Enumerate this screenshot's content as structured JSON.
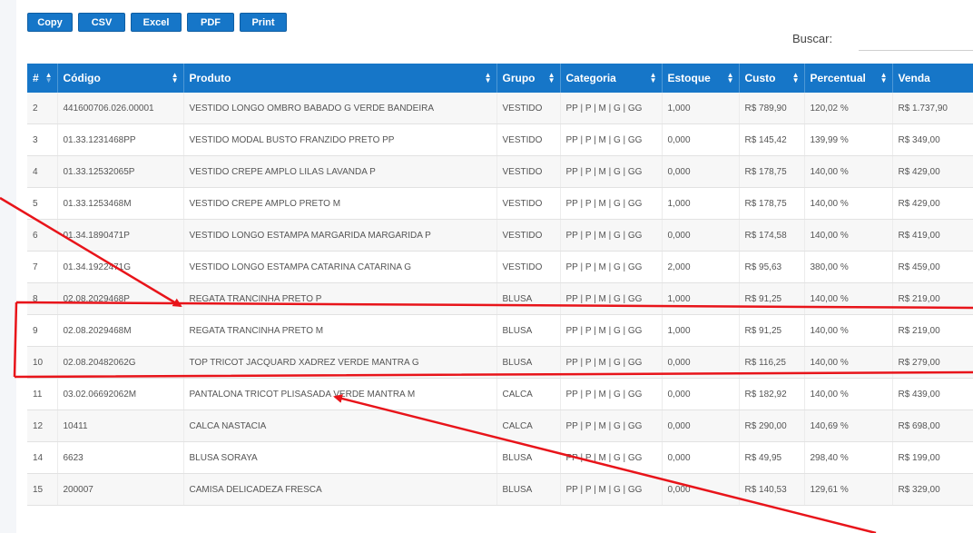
{
  "toolbar": {
    "copy_label": "Copy",
    "csv_label": "CSV",
    "excel_label": "Excel",
    "pdf_label": "PDF",
    "print_label": "Print"
  },
  "search": {
    "label": "Buscar:",
    "value": ""
  },
  "table": {
    "headers": [
      "#",
      "Código",
      "Produto",
      "Grupo",
      "Categoria",
      "Estoque",
      "Custo",
      "Percentual",
      "Venda"
    ],
    "rows": [
      [
        "2",
        "441600706.026.00001",
        "VESTIDO LONGO OMBRO BABADO G VERDE BANDEIRA",
        "VESTIDO",
        "PP | P | M | G | GG",
        "1,000",
        "R$ 789,90",
        "120,02 %",
        "R$ 1.737,90"
      ],
      [
        "3",
        "01.33.1231468PP",
        "VESTIDO MODAL BUSTO FRANZIDO PRETO PP",
        "VESTIDO",
        "PP | P | M | G | GG",
        "0,000",
        "R$ 145,42",
        "139,99 %",
        "R$ 349,00"
      ],
      [
        "4",
        "01.33.12532065P",
        "VESTIDO CREPE AMPLO LILAS LAVANDA P",
        "VESTIDO",
        "PP | P | M | G | GG",
        "0,000",
        "R$ 178,75",
        "140,00 %",
        "R$ 429,00"
      ],
      [
        "5",
        "01.33.1253468M",
        "VESTIDO CREPE AMPLO PRETO M",
        "VESTIDO",
        "PP | P | M | G | GG",
        "1,000",
        "R$ 178,75",
        "140,00 %",
        "R$ 429,00"
      ],
      [
        "6",
        "01.34.1890471P",
        "VESTIDO LONGO ESTAMPA MARGARIDA MARGARIDA P",
        "VESTIDO",
        "PP | P | M | G | GG",
        "0,000",
        "R$ 174,58",
        "140,00 %",
        "R$ 419,00"
      ],
      [
        "7",
        "01.34.1922471G",
        "VESTIDO LONGO ESTAMPA CATARINA CATARINA G",
        "VESTIDO",
        "PP | P | M | G | GG",
        "2,000",
        "R$ 95,63",
        "380,00 %",
        "R$ 459,00"
      ],
      [
        "8",
        "02.08.2029468P",
        "REGATA TRANCINHA PRETO P",
        "BLUSA",
        "PP | P | M | G | GG",
        "1,000",
        "R$ 91,25",
        "140,00 %",
        "R$ 219,00"
      ],
      [
        "9",
        "02.08.2029468M",
        "REGATA TRANCINHA PRETO M",
        "BLUSA",
        "PP | P | M | G | GG",
        "1,000",
        "R$ 91,25",
        "140,00 %",
        "R$ 219,00"
      ],
      [
        "10",
        "02.08.20482062G",
        "TOP TRICOT JACQUARD XADREZ VERDE MANTRA G",
        "BLUSA",
        "PP | P | M | G | GG",
        "0,000",
        "R$ 116,25",
        "140,00 %",
        "R$ 279,00"
      ],
      [
        "11",
        "03.02.06692062M",
        "PANTALONA TRICOT PLISASADA VERDE MANTRA M",
        "CALCA",
        "PP | P | M | G | GG",
        "0,000",
        "R$ 182,92",
        "140,00 %",
        "R$ 439,00"
      ],
      [
        "12",
        "10411",
        "CALCA NASTACIA",
        "CALCA",
        "PP | P | M | G | GG",
        "0,000",
        "R$ 290,00",
        "140,69 %",
        "R$ 698,00"
      ],
      [
        "14",
        "6623",
        "BLUSA SORAYA",
        "BLUSA",
        "PP | P | M | G | GG",
        "0,000",
        "R$ 49,95",
        "298,40 %",
        "R$ 199,00"
      ],
      [
        "15",
        "200007",
        "CAMISA DELICADEZA FRESCA",
        "BLUSA",
        "PP | P | M | G | GG",
        "0,000",
        "R$ 140,53",
        "129,61 %",
        "R$ 329,00"
      ]
    ]
  },
  "colors": {
    "header_bg": "#1676c8",
    "annotation": "#e8141a"
  }
}
